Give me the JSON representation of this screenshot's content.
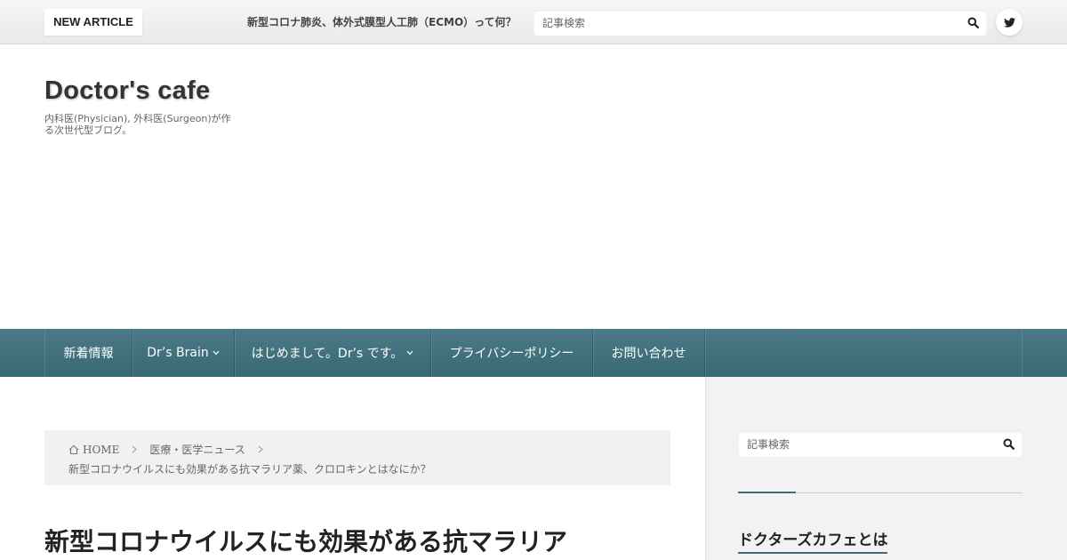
{
  "topbar": {
    "new_article_label": "NEW ARTICLE",
    "ticker_text": "新型コロナ肺炎、体外式膜型人工肺（ECMO）って何？",
    "search_placeholder": "記事検索"
  },
  "header": {
    "site_title": "Doctor's cafe",
    "site_description": "内科医(Physician), 外科医(Surgeon)が作る次世代型ブログ。"
  },
  "nav": {
    "items": [
      {
        "label": "新着情報",
        "has_dropdown": false
      },
      {
        "label": "Dr’s Brain",
        "has_dropdown": true
      },
      {
        "label": "はじめまして。Dr’s です。",
        "has_dropdown": true
      },
      {
        "label": "プライバシーポリシー",
        "has_dropdown": false
      },
      {
        "label": "お問い合わせ",
        "has_dropdown": false
      }
    ]
  },
  "breadcrumb": {
    "home": "HOME",
    "category": "医療・医学ニュース",
    "current": "新型コロナウイルスにも効果がある抗マラリア薬、クロロキンとはなにか？"
  },
  "article": {
    "title": "新型コロナウイルスにも効果がある抗マラリア"
  },
  "sidebar": {
    "search_placeholder": "記事検索",
    "heading": "ドクターズカフェとは"
  },
  "colors": {
    "nav_bg": "#3d6c78",
    "accent": "#3d6c78",
    "topbar_bg": "#efefef",
    "sidebar_bg": "#f2f2f2"
  },
  "icons": [
    "search-icon",
    "twitter-icon",
    "home-icon",
    "chevron-right-icon",
    "chevron-down-icon"
  ]
}
